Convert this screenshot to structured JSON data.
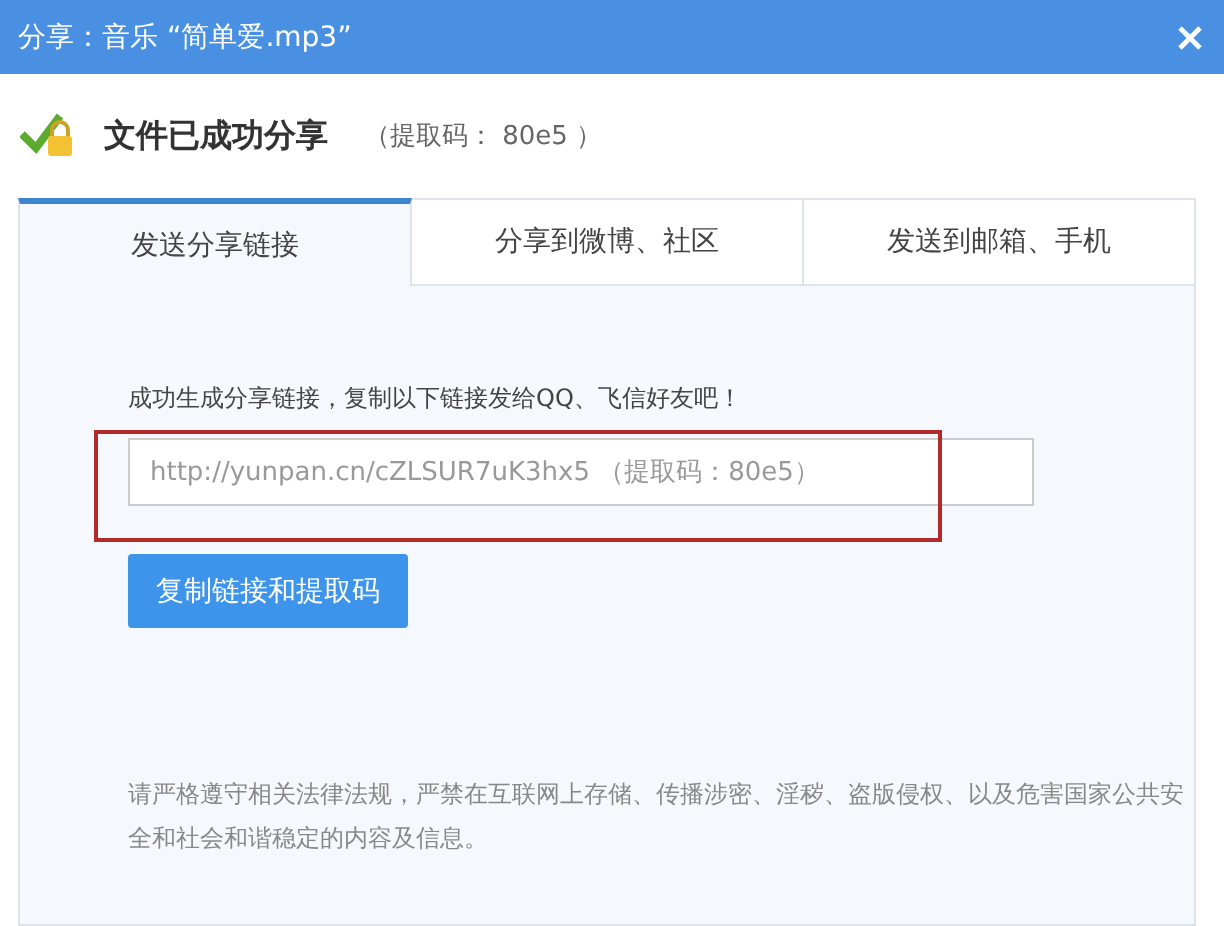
{
  "window": {
    "title": "分享：音乐 “简单爱.mp3”"
  },
  "header": {
    "title": "文件已成功分享",
    "code": "（提取码： 80e5 ）"
  },
  "tabs": [
    {
      "label": "发送分享链接",
      "selected": true
    },
    {
      "label": "分享到微博、社区",
      "selected": false
    },
    {
      "label": "发送到邮箱、手机",
      "selected": false
    }
  ],
  "panel": {
    "instruction": "成功生成分享链接，复制以下链接发给QQ、飞信好友吧！",
    "link_field": {
      "value": "http://yunpan.cn/cZLSUR7uK3hx5 （提取码：80e5）"
    },
    "copy_button": "复制链接和提取码",
    "notice": "请严格遵守相关法律法规，严禁在互联网上存储、传播涉密、淫秽、盗版侵权、以及危害国家公共安全和社会和谐稳定的内容及信息。"
  }
}
